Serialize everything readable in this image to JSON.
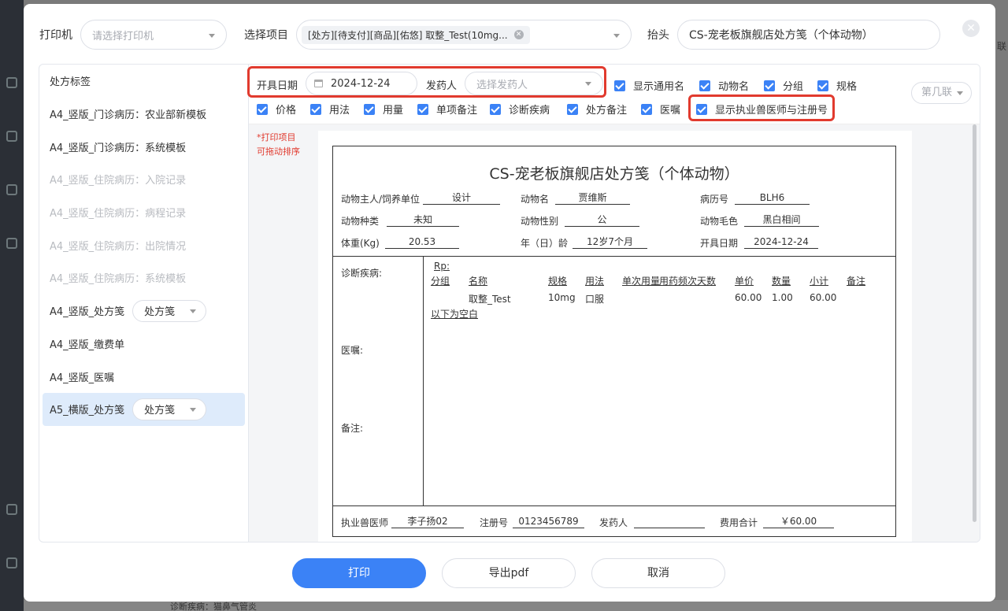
{
  "background": {
    "bottom_text": "诊断疾病：猫鼻气管炎",
    "right_text": "联"
  },
  "header": {
    "printer_label": "打印机",
    "printer_placeholder": "请选择打印机",
    "item_label": "选择项目",
    "item_tag": "[处方][待支付][商品][佑悠] 取整_Test(10mg...",
    "title_label": "抬头",
    "title_value": "CS-宠老板旗舰店处方笺（个体动物）"
  },
  "sidebar": {
    "items": [
      {
        "label": "处方标签",
        "dim": false
      },
      {
        "label": "A4_竖版_门诊病历：农业部新模板",
        "dim": false
      },
      {
        "label": "A4_竖版_门诊病历：系统模板",
        "dim": false
      },
      {
        "label": "A4_竖版_住院病历：入院记录",
        "dim": true
      },
      {
        "label": "A4_竖版_住院病历：病程记录",
        "dim": true
      },
      {
        "label": "A4_竖版_住院病历：出院情况",
        "dim": true
      },
      {
        "label": "A4_竖版_住院病历：系统模板",
        "dim": true
      },
      {
        "label": "A4_竖版_处方笺",
        "dim": false,
        "select": "处方笺"
      },
      {
        "label": "A4_竖版_缴费单",
        "dim": false
      },
      {
        "label": "A4_竖版_医嘱",
        "dim": false
      },
      {
        "label": "A5_横版_处方笺",
        "dim": false,
        "select": "处方笺",
        "active": true
      }
    ]
  },
  "filters": {
    "date_label": "开具日期",
    "date_value": "2024-12-24",
    "dispenser_label": "发药人",
    "dispenser_placeholder": "选择发药人",
    "page_placeholder": "第几联",
    "checkboxes": [
      "显示通用名",
      "动物名",
      "分组",
      "规格",
      "价格",
      "用法",
      "用量",
      "单项备注",
      "诊断疾病",
      "处方备注",
      "医嘱",
      "显示执业兽医师与注册号"
    ]
  },
  "hint": {
    "line1": "*打印项目",
    "line2": "可拖动排序"
  },
  "prescription": {
    "title": "CS-宠老板旗舰店处方笺（个体动物）",
    "owner_label": "动物主人/饲养单位",
    "owner": "设计",
    "animal_name_label": "动物名",
    "animal_name": "贾维斯",
    "record_label": "病历号",
    "record": "BLH6",
    "species_label": "动物种类",
    "species": "未知",
    "sex_label": "动物性别",
    "sex": "公",
    "color_label": "动物毛色",
    "color": "黑白相间",
    "weight_label": "体重(Kg)",
    "weight": "20.53",
    "age_label": "年（日）龄",
    "age": "12岁7个月",
    "date_label": "开具日期",
    "date": "2024-12-24",
    "diag_label": "诊断疾病:",
    "advice_label": "医嘱:",
    "remark_label": "备注:",
    "rp": "Rp:",
    "columns": [
      "分组",
      "名称",
      "规格",
      "用法",
      "单次用量",
      "用药频次",
      "天数",
      "单价",
      "数量",
      "小计",
      "备注"
    ],
    "row": {
      "name": "取整_Test",
      "spec": "10mg",
      "usage": "口服",
      "price": "60.00",
      "qty": "1.00",
      "subtotal": "60.00"
    },
    "blank_note": "以下为空白",
    "vet_label": "执业兽医师",
    "vet": "李子扬02",
    "reg_label": "注册号",
    "reg": "0123456789",
    "dispenser_label": "发药人",
    "dispenser": "",
    "total_label": "费用合计",
    "total": "￥60.00"
  },
  "buttons": {
    "print": "打印",
    "export": "导出pdf",
    "cancel": "取消"
  },
  "colors": {
    "primary": "#3b82f6",
    "highlight_box": "#e13a2e",
    "active_item_bg": "#deebfb"
  }
}
